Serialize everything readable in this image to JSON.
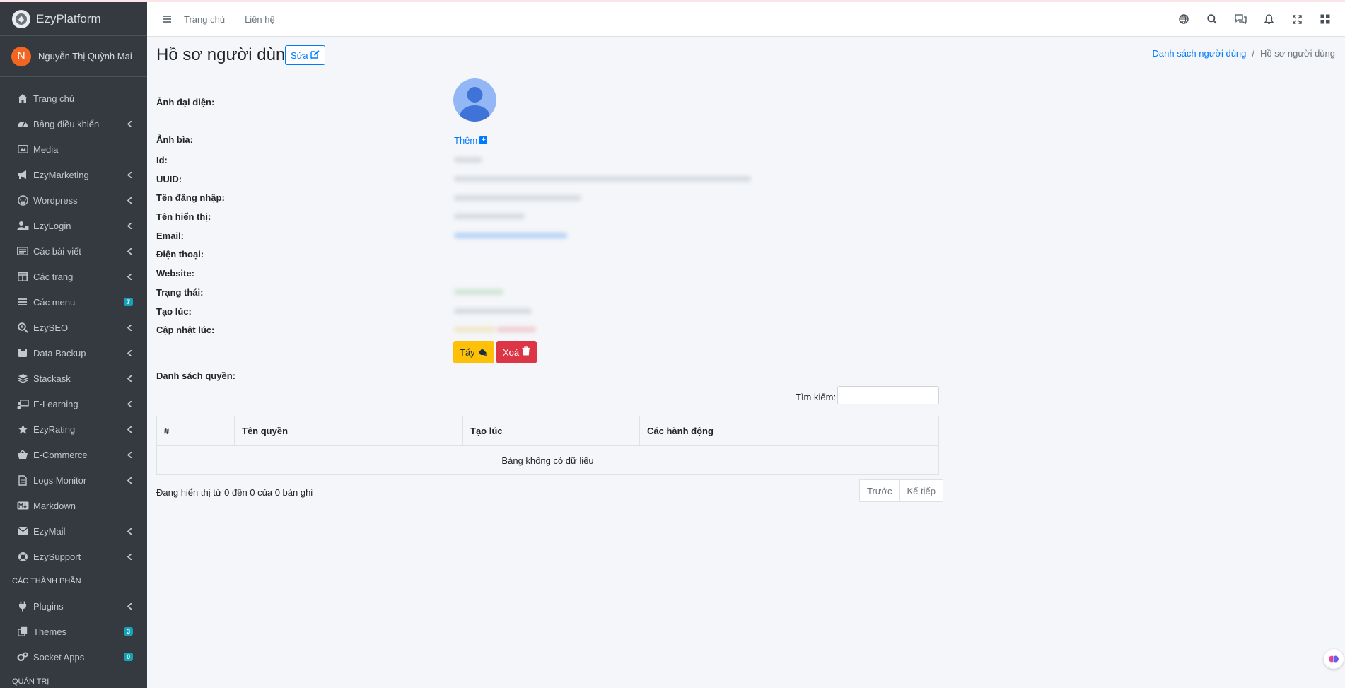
{
  "brand": {
    "name": "EzyPlatform"
  },
  "user": {
    "initial": "N",
    "name": "Nguyễn Thị Quỳnh Mai"
  },
  "sidebar": {
    "items": [
      {
        "label": "Trang chủ",
        "icon": "home-icon",
        "has_children": false
      },
      {
        "label": "Bảng điều khiển",
        "icon": "dashboard-icon",
        "has_children": true
      },
      {
        "label": "Media",
        "icon": "image-icon",
        "has_children": false
      },
      {
        "label": "EzyMarketing",
        "icon": "megaphone-icon",
        "has_children": true
      },
      {
        "label": "Wordpress",
        "icon": "wordpress-icon",
        "has_children": true
      },
      {
        "label": "EzyLogin",
        "icon": "user-lock-icon",
        "has_children": true
      },
      {
        "label": "Các bài viết",
        "icon": "newspaper-icon",
        "has_children": true
      },
      {
        "label": "Các trang",
        "icon": "columns-icon",
        "has_children": true
      },
      {
        "label": "Các menu",
        "icon": "bars-icon",
        "has_children": false,
        "badge": "7"
      },
      {
        "label": "EzySEO",
        "icon": "search-plus-icon",
        "has_children": true
      },
      {
        "label": "Data Backup",
        "icon": "archive-icon",
        "has_children": true
      },
      {
        "label": "Stackask",
        "icon": "layers-icon",
        "has_children": true
      },
      {
        "label": "E-Learning",
        "icon": "teacher-icon",
        "has_children": true
      },
      {
        "label": "EzyRating",
        "icon": "star-icon",
        "has_children": true
      },
      {
        "label": "E-Commerce",
        "icon": "basket-icon",
        "has_children": true
      },
      {
        "label": "Logs Monitor",
        "icon": "file-icon",
        "has_children": true
      },
      {
        "label": "Markdown",
        "icon": "markdown-icon",
        "has_children": false
      },
      {
        "label": "EzyMail",
        "icon": "envelope-icon",
        "has_children": true
      },
      {
        "label": "EzySupport",
        "icon": "life-ring-icon",
        "has_children": true
      }
    ],
    "section_components": "CÁC THÀNH PHẦN",
    "component_items": [
      {
        "label": "Plugins",
        "icon": "plug-icon",
        "has_children": true
      },
      {
        "label": "Themes",
        "icon": "clone-icon",
        "has_children": false,
        "badge": "3"
      },
      {
        "label": "Socket Apps",
        "icon": "cogs-icon",
        "has_children": false,
        "badge": "0"
      }
    ],
    "section_admin": "QUẢN TRỊ"
  },
  "topnav": {
    "links": [
      "Trang chủ",
      "Liên hệ"
    ],
    "icons": [
      "globe-icon",
      "search-icon",
      "comments-icon",
      "bell-icon",
      "expand-icon",
      "apps-icon"
    ]
  },
  "page": {
    "title": "Hồ sơ người dùng",
    "edit_label": "Sửa",
    "breadcrumb": {
      "parent": "Danh sách người dùng",
      "current": "Hồ sơ người dùng"
    }
  },
  "profile": {
    "labels": {
      "avatar": "Ảnh đại diện:",
      "cover": "Ảnh bìa:",
      "id": "Id:",
      "uuid": "UUID:",
      "username": "Tên đăng nhập:",
      "display_name": "Tên hiển thị:",
      "email": "Email:",
      "phone": "Điện thoại:",
      "website": "Website:",
      "status": "Trạng thái:",
      "created_at": "Tạo lúc:",
      "updated_at": "Cập nhật lúc:"
    },
    "add_cover_label": "Thêm",
    "wipe_label": "Tẩy",
    "delete_label": "Xoá"
  },
  "permissions": {
    "title": "Danh sách quyền:",
    "search_label": "Tìm kiếm:",
    "search_value": "",
    "columns": [
      "#",
      "Tên quyền",
      "Tạo lúc",
      "Các hành động"
    ],
    "empty_text": "Bảng không có dữ liệu",
    "info": "Đang hiển thị từ 0 đến 0 của 0 bản ghi",
    "prev_label": "Trước",
    "next_label": "Kế tiếp"
  },
  "colors": {
    "sidebar_bg": "#343a40",
    "primary": "#007bff",
    "warning": "#ffc107",
    "danger": "#dc3545",
    "badge_info": "#17a2b8"
  }
}
